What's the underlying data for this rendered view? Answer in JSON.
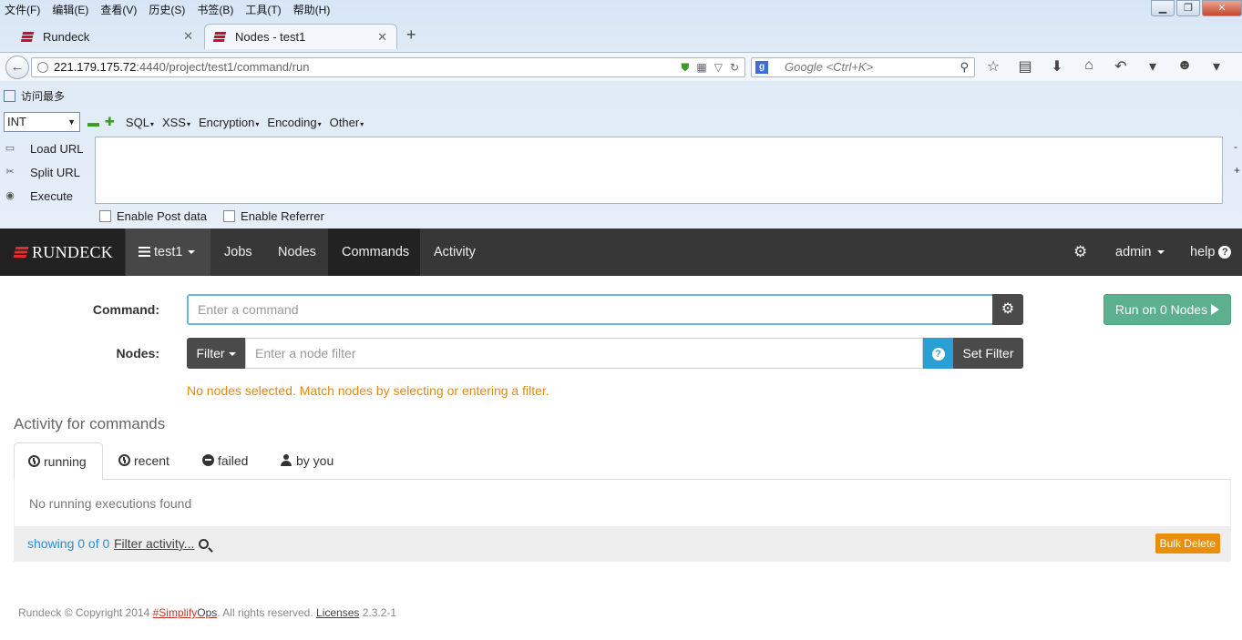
{
  "browser": {
    "menu": [
      "文件(F)",
      "编辑(E)",
      "查看(V)",
      "历史(S)",
      "书签(B)",
      "工具(T)",
      "帮助(H)"
    ],
    "tabs": [
      {
        "title": "Rundeck",
        "active": false
      },
      {
        "title": "Nodes - test1",
        "active": true
      }
    ],
    "url_host": "221.179.175.72",
    "url_rest": ":4440/project/test1/command/run",
    "search_placeholder": "Google <Ctrl+K>",
    "bookmark": "访问最多"
  },
  "hackbar": {
    "select_value": "INT",
    "menus": [
      "SQL",
      "XSS",
      "Encryption",
      "Encoding",
      "Other"
    ],
    "actions": [
      "Load URL",
      "Split URL",
      "Execute"
    ],
    "post_data_label": "Enable Post data",
    "referrer_label": "Enable Referrer"
  },
  "rundeck_nav": {
    "brand": "RUNDECK",
    "project": "test1",
    "items": [
      "Jobs",
      "Nodes",
      "Commands",
      "Activity"
    ],
    "active_item": "Commands",
    "user": "admin",
    "help": "help"
  },
  "command_form": {
    "command_label": "Command:",
    "command_placeholder": "Enter a command",
    "run_button": "Run on 0 Nodes",
    "nodes_label": "Nodes:",
    "filter_button": "Filter",
    "node_filter_placeholder": "Enter a node filter",
    "set_filter_button": "Set Filter",
    "warning": "No nodes selected. Match nodes by selecting or entering a filter."
  },
  "activity": {
    "title": "Activity for commands",
    "tabs": [
      "running",
      "recent",
      "failed",
      "by you"
    ],
    "empty_message": "No running executions found",
    "showing": "showing 0 of 0",
    "filter_link": "Filter activity...",
    "bulk_delete": "Bulk Delete"
  },
  "footer": {
    "prefix": "Rundeck © Copyright 2014 ",
    "hash": "#Simplify",
    "ops": "Ops",
    "middle": ". All rights reserved. ",
    "licenses": "Licenses",
    "version": " 2.3.2-1"
  },
  "colors": {
    "navbar": "#373737",
    "run_button": "#5cb08e",
    "help_button": "#2a9fd6",
    "warning": "#e08a10",
    "bulk_delete": "#e8900c"
  }
}
